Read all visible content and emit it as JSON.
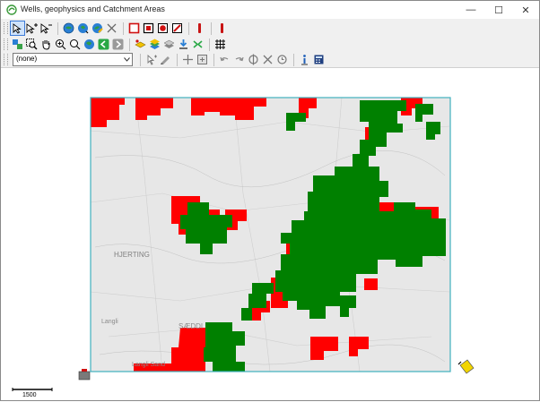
{
  "window": {
    "title": "Wells, geophysics and Catchment Areas",
    "controls": [
      "minimize",
      "maximize",
      "close"
    ],
    "minimize_glyph": "—",
    "maximize_glyph": "☐",
    "close_glyph": "✕"
  },
  "toolbar": {
    "row1": [
      "select-arrow-icon",
      "select-add-icon",
      "select-remove-icon",
      "identify-icon",
      "refresh-icon",
      "edit-icon",
      "delete-icon",
      "rect-red-icon",
      "rect-dark-icon",
      "circle-red-icon",
      "no-entry-icon",
      "red-bar-icon",
      "red-bar-2-icon"
    ],
    "row2": [
      "layers-icon",
      "zoom-window-icon",
      "pan-hand-icon",
      "zoom-in-icon",
      "zoom-out-icon",
      "globe-icon",
      "back-icon",
      "forward-icon",
      "layer-yellow-icon",
      "layer-stack-icon",
      "layer-move-icon",
      "download-icon",
      "merge-icon",
      "grid-icon"
    ],
    "row3": [
      "pointer-icon",
      "draw-icon",
      "crosshair-icon",
      "snap-icon",
      "undo-icon",
      "redo-icon",
      "target-icon",
      "cancel-icon",
      "history-icon",
      "info-icon",
      "calculator-icon"
    ],
    "combo_value": "(none)"
  },
  "map": {
    "place_labels": [
      "HJERTING",
      "Langli",
      "SÆDDI",
      "Langli Sand"
    ],
    "colors": {
      "border": "#3fb0bf",
      "catchment_red": "#ff0000",
      "catchment_green": "#008000",
      "map_base": "#e7e7e7"
    }
  },
  "scale_bar": {
    "label": "1500"
  }
}
